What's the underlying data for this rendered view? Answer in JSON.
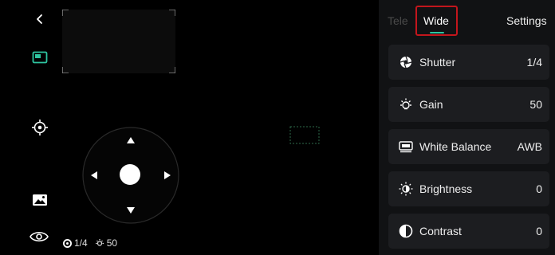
{
  "status": {
    "shutter_value": "1/4",
    "gain_value": "50"
  },
  "tabs": {
    "tele": "Tele",
    "wide": "Wide",
    "settings": "Settings"
  },
  "settings": [
    {
      "label": "Shutter",
      "value": "1/4",
      "icon": "shutter-icon"
    },
    {
      "label": "Gain",
      "value": "50",
      "icon": "gain-icon"
    },
    {
      "label": "White Balance",
      "value": "AWB",
      "icon": "white-balance-icon"
    },
    {
      "label": "Brightness",
      "value": "0",
      "icon": "brightness-icon"
    },
    {
      "label": "Contrast",
      "value": "0",
      "icon": "contrast-icon"
    }
  ],
  "colors": {
    "accent": "#2ec4a0",
    "highlight_border": "#c3161c"
  }
}
